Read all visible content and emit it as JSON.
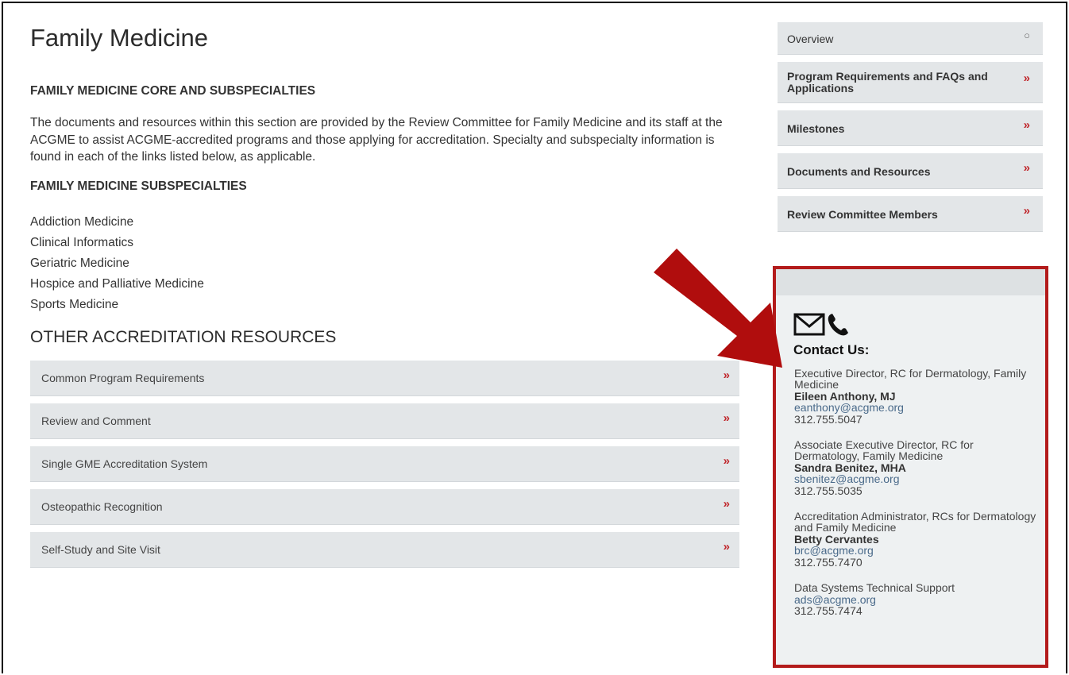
{
  "page": {
    "title": "Family Medicine"
  },
  "core": {
    "heading": "FAMILY MEDICINE CORE AND SUBSPECIALTIES",
    "intro": "The documents and resources within this section are provided by the Review Committee for Family Medicine and its staff at the ACGME to assist ACGME-accredited programs and those applying for accreditation. Specialty and subspecialty information is found in each of the links listed below, as applicable."
  },
  "subspecialties": {
    "heading": "FAMILY MEDICINE SUBSPECIALTIES",
    "items": [
      "Addiction Medicine",
      "Clinical Informatics",
      "Geriatric Medicine",
      "Hospice and Palliative Medicine",
      "Sports Medicine"
    ]
  },
  "other": {
    "heading": "OTHER ACCREDITATION RESOURCES",
    "items": [
      "Common Program Requirements",
      "Review and Comment",
      "Single GME Accreditation System",
      "Osteopathic Recognition",
      "Self-Study and Site Visit"
    ]
  },
  "sidebar": {
    "items": [
      "Overview",
      "Program Requirements and FAQs and Applications",
      "Milestones",
      "Documents and Resources",
      "Review Committee Members"
    ]
  },
  "contact": {
    "title": "Contact Us:",
    "people": [
      {
        "role": "Executive Director, RC for Dermatology, Family Medicine",
        "name": "Eileen Anthony, MJ",
        "email": "eanthony@acgme.org",
        "phone": "312.755.5047"
      },
      {
        "role": "Associate Executive Director, RC for Dermatology, Family Medicine",
        "name": "Sandra Benitez, MHA",
        "email": "sbenitez@acgme.org",
        "phone": "312.755.5035"
      },
      {
        "role": "Accreditation Administrator, RCs for Dermatology and Family Medicine",
        "name": "Betty Cervantes",
        "email": "brc@acgme.org",
        "phone": "312.755.7470"
      },
      {
        "role": "Data Systems Technical Support",
        "name": "",
        "email": "ads@acgme.org",
        "phone": "312.755.7474"
      }
    ]
  },
  "icons": {
    "chevron": "»",
    "circle": "○",
    "mail": "envelope-icon",
    "phone": "phone-icon"
  },
  "colors": {
    "accent": "#c0262b",
    "arrow": "#b00d0d",
    "panel": "#e3e6e8"
  }
}
